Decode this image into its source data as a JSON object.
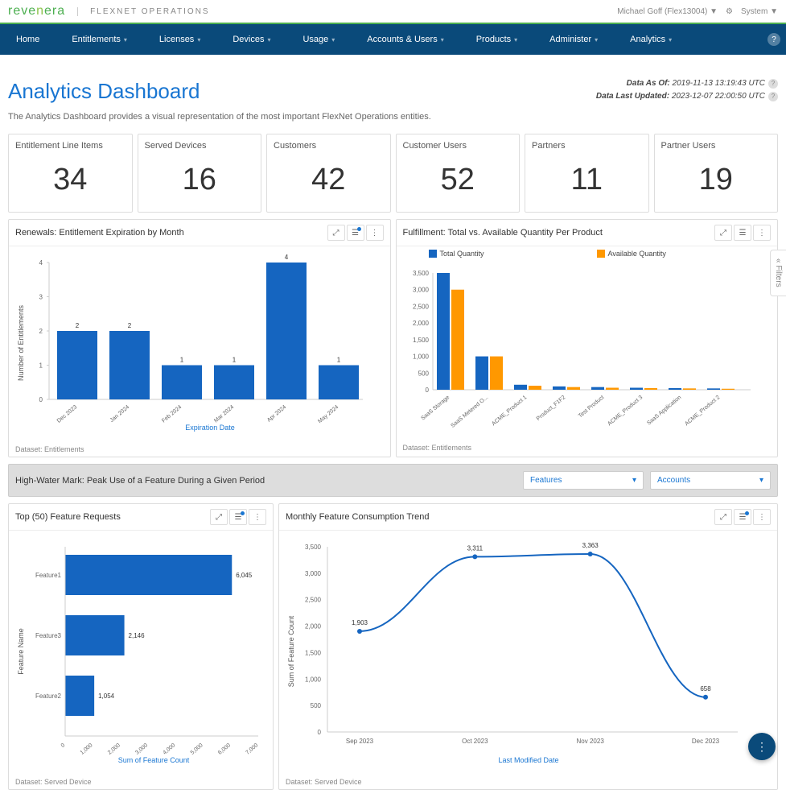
{
  "topbar": {
    "logo": "revenera",
    "app_name": "FLEXNET OPERATIONS",
    "user": "Michael Goff (Flex13004) ▼",
    "system": "System ▼"
  },
  "nav": {
    "items": [
      "Home",
      "Entitlements",
      "Licenses",
      "Devices",
      "Usage",
      "Accounts & Users",
      "Products",
      "Administer",
      "Analytics"
    ]
  },
  "header": {
    "title": "Analytics Dashboard",
    "desc": "The Analytics Dashboard provides a visual representation of the most important FlexNet Operations entities.",
    "data_as_of_label": "Data As Of:",
    "data_as_of": "2019-11-13 13:19:43 UTC",
    "data_updated_label": "Data Last Updated:",
    "data_updated": "2023-12-07 22:00:50 UTC"
  },
  "kpis": [
    {
      "title": "Entitlement Line Items",
      "value": "34"
    },
    {
      "title": "Served Devices",
      "value": "16"
    },
    {
      "title": "Customers",
      "value": "42"
    },
    {
      "title": "Customer Users",
      "value": "52"
    },
    {
      "title": "Partners",
      "value": "11"
    },
    {
      "title": "Partner Users",
      "value": "19"
    }
  ],
  "renewals": {
    "title": "Renewals: Entitlement Expiration by Month",
    "dataset": "Dataset: Entitlements",
    "xlabel": "Expiration Date",
    "ylabel": "Number of Entitlements"
  },
  "fulfillment": {
    "title": "Fulfillment: Total vs. Available Quantity Per Product",
    "dataset": "Dataset: Entitlements",
    "legend_total": "Total Quantity",
    "legend_avail": "Available Quantity"
  },
  "highwater": {
    "title": "High-Water Mark: Peak Use of a Feature During a Given Period",
    "dropdown1": "Features",
    "dropdown2": "Accounts"
  },
  "top50": {
    "title": "Top (50) Feature Requests",
    "dataset": "Dataset: Served Device",
    "xlabel": "Sum of Feature Count",
    "ylabel": "Feature Name"
  },
  "trend": {
    "title": "Monthly Feature Consumption Trend",
    "dataset": "Dataset: Served Device",
    "xlabel": "Last Modified Date",
    "ylabel": "Sum of Feature Count"
  },
  "filters_tab": "Filters",
  "chart_data": [
    {
      "id": "renewals",
      "type": "bar",
      "categories": [
        "Dec 2023",
        "Jan 2024",
        "Feb 2024",
        "Mar 2024",
        "Apr 2024",
        "May 2024"
      ],
      "values": [
        2,
        2,
        1,
        1,
        4,
        1
      ],
      "title": "Renewals: Entitlement Expiration by Month",
      "xlabel": "Expiration Date",
      "ylabel": "Number of Entitlements",
      "ylim": [
        0,
        4
      ]
    },
    {
      "id": "fulfillment",
      "type": "bar",
      "categories": [
        "SaaS Storage",
        "SaaS Metered O...",
        "ACME_Product 1",
        "Product_F1F2",
        "Test Product",
        "ACME_Product 3",
        "SaaS Application",
        "ACME_Product 2"
      ],
      "series": [
        {
          "name": "Total Quantity",
          "values": [
            3500,
            1000,
            150,
            100,
            80,
            60,
            50,
            40
          ]
        },
        {
          "name": "Available Quantity",
          "values": [
            3000,
            1000,
            120,
            80,
            60,
            50,
            40,
            30
          ]
        }
      ],
      "title": "Fulfillment: Total vs. Available Quantity Per Product",
      "ylim": [
        0,
        3500
      ]
    },
    {
      "id": "top50",
      "type": "bar",
      "orientation": "horizontal",
      "categories": [
        "Feature1",
        "Feature3",
        "Feature2"
      ],
      "values": [
        6045,
        2146,
        1054
      ],
      "title": "Top (50) Feature Requests",
      "xlabel": "Sum of Feature Count",
      "ylabel": "Feature Name",
      "xlim": [
        0,
        7000
      ]
    },
    {
      "id": "trend",
      "type": "line",
      "x": [
        "Sep 2023",
        "Oct 2023",
        "Nov 2023",
        "Dec 2023"
      ],
      "values": [
        1903,
        3311,
        3363,
        658
      ],
      "title": "Monthly Feature Consumption Trend",
      "xlabel": "Last Modified Date",
      "ylabel": "Sum of Feature Count",
      "ylim": [
        0,
        3500
      ]
    }
  ]
}
